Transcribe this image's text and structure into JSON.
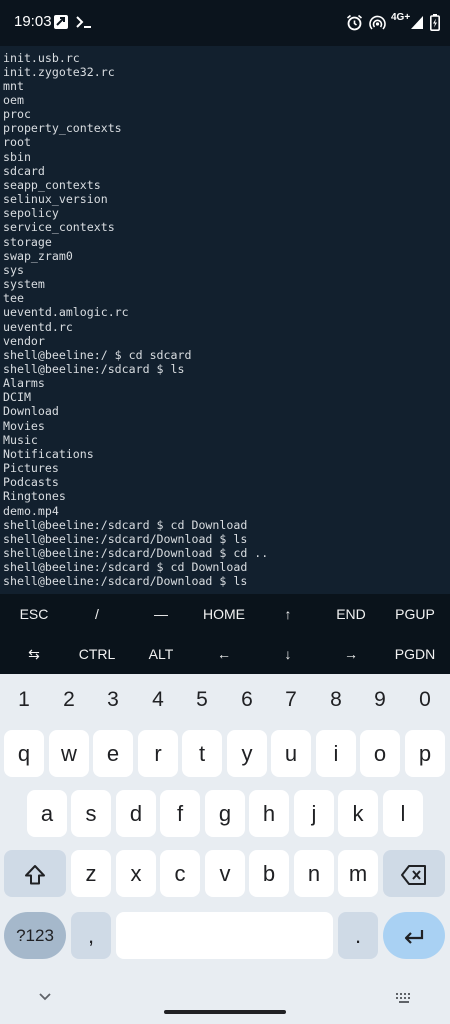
{
  "status_bar": {
    "time": "19:03",
    "network": "4G+",
    "icons": [
      "app-notification-icon",
      "terminal-prompt-icon",
      "alarm-icon",
      "hotspot-icon",
      "signal-icon",
      "battery-icon"
    ]
  },
  "terminal": {
    "lines": [
      "init.usb.rc",
      "init.zygote32.rc",
      "mnt",
      "oem",
      "proc",
      "property_contexts",
      "root",
      "sbin",
      "sdcard",
      "seapp_contexts",
      "selinux_version",
      "sepolicy",
      "service_contexts",
      "storage",
      "swap_zram0",
      "sys",
      "system",
      "tee",
      "ueventd.amlogic.rc",
      "ueventd.rc",
      "vendor",
      "shell@beeline:/ $ cd sdcard",
      "shell@beeline:/sdcard $ ls",
      "Alarms",
      "DCIM",
      "Download",
      "Movies",
      "Music",
      "Notifications",
      "Pictures",
      "Podcasts",
      "Ringtones",
      "demo.mp4",
      "shell@beeline:/sdcard $ cd Download",
      "shell@beeline:/sdcard/Download $ ls",
      "shell@beeline:/sdcard/Download $ cd ..",
      "shell@beeline:/sdcard $ cd Download",
      "shell@beeline:/sdcard/Download $ ls"
    ]
  },
  "extra_keys": {
    "row1": [
      "ESC",
      "/",
      "—",
      "HOME",
      "↑",
      "END",
      "PGUP"
    ],
    "row2": [
      "⇆",
      "CTRL",
      "ALT",
      "←",
      "↓",
      "→",
      "PGDN"
    ]
  },
  "keyboard": {
    "numbers": [
      "1",
      "2",
      "3",
      "4",
      "5",
      "6",
      "7",
      "8",
      "9",
      "0"
    ],
    "row1": [
      "q",
      "w",
      "e",
      "r",
      "t",
      "y",
      "u",
      "i",
      "o",
      "p"
    ],
    "row2": [
      "a",
      "s",
      "d",
      "f",
      "g",
      "h",
      "j",
      "k",
      "l"
    ],
    "row3": [
      "z",
      "x",
      "c",
      "v",
      "b",
      "n",
      "m"
    ],
    "symbols_label": "?123",
    "comma": ",",
    "period": ".",
    "shift_icon": "shift-icon",
    "backspace_icon": "backspace-icon",
    "enter_icon": "enter-icon"
  },
  "colors": {
    "terminal_bg": "#12202e",
    "terminal_text": "#d9dde1",
    "extra_keys_bg": "#0a131b",
    "keyboard_bg": "#e8edf2",
    "key_bg": "#ffffff",
    "enter_key_bg": "#a9d1f3"
  }
}
